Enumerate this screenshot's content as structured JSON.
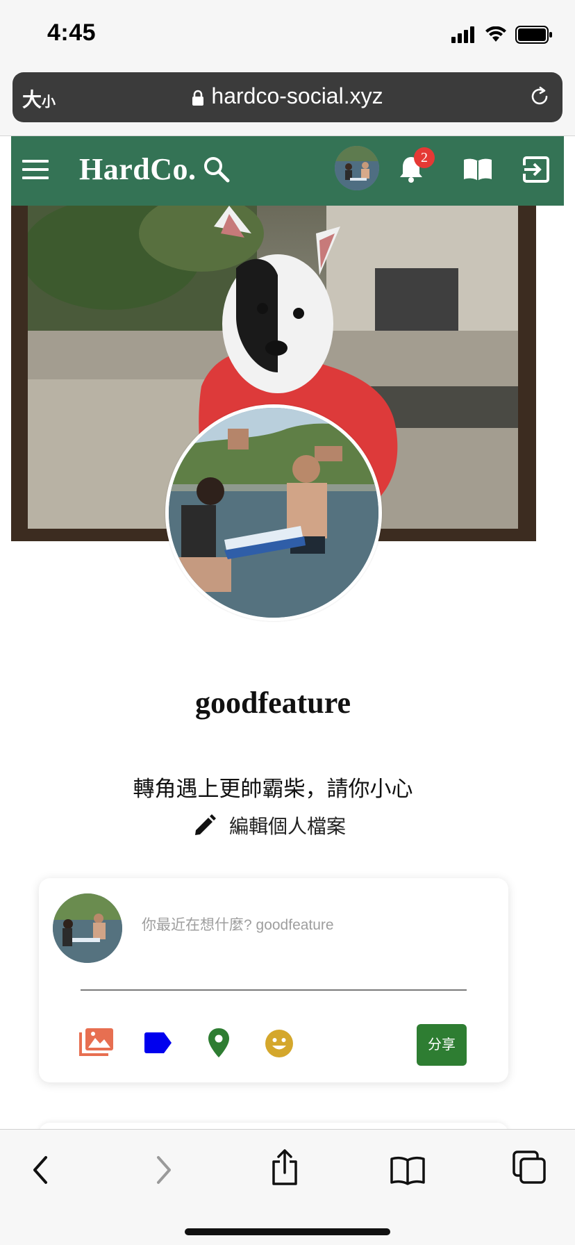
{
  "status_bar": {
    "time": "4:45"
  },
  "browser": {
    "text_size_label": "大",
    "text_size_small": "小",
    "url": "hardco-social.xyz"
  },
  "site_nav": {
    "logo": "HardCo.",
    "notification_count": "2"
  },
  "profile": {
    "username": "goodfeature",
    "bio": "轉角遇上更帥霸柴，請你小心",
    "edit_label": "編輯個人檔案"
  },
  "composer": {
    "placeholder": "你最近在想什麼? goodfeature",
    "share_label": "分享",
    "tools": [
      "photo-icon",
      "tag-icon",
      "location-icon",
      "emoji-icon"
    ]
  },
  "colors": {
    "nav_green": "#347355",
    "share_green": "#2e7d32",
    "photo_icon": "#e76f51",
    "tag_icon": "#0000ee",
    "location_icon": "#2e7d32",
    "emoji_icon": "#d4a72c",
    "badge_red": "#e53935"
  }
}
